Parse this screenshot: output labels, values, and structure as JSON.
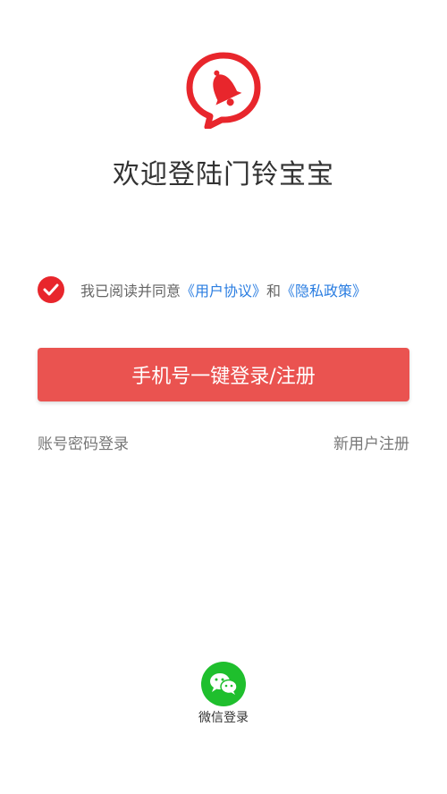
{
  "header": {
    "title": "欢迎登陆门铃宝宝"
  },
  "agreement": {
    "checked": true,
    "prefix": "我已阅读并同意",
    "user_agreement": "《用户协议》",
    "conjunction": "和",
    "privacy_policy": "《隐私政策》"
  },
  "actions": {
    "primary_button": "手机号一键登录/注册",
    "account_login": "账号密码登录",
    "new_user_register": "新用户注册"
  },
  "third_party": {
    "wechat_label": "微信登录",
    "wechat_icon": "wechat-icon"
  },
  "colors": {
    "brand_red": "#e8262c",
    "button_red": "#ea5350",
    "link_blue": "#2a7de1",
    "wechat_green": "#1fbf2d"
  }
}
